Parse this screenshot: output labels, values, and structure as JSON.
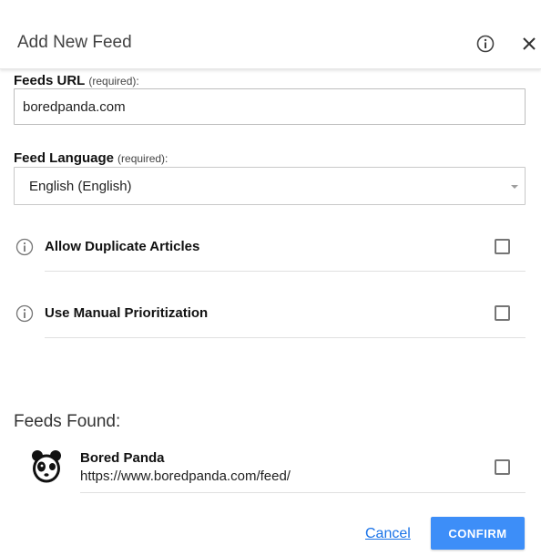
{
  "dialog": {
    "title": "Add New Feed",
    "info_icon": "info-circle-icon",
    "close_icon": "close-icon"
  },
  "feeds_url": {
    "label": "Feeds URL",
    "required_note": "(required):",
    "value": "boredpanda.com"
  },
  "feed_language": {
    "label": "Feed Language",
    "required_note": "(required):",
    "selected": "English (English)"
  },
  "options": [
    {
      "label": "Allow Duplicate Articles",
      "icon": "info-circle-icon",
      "checked": false
    },
    {
      "label": "Use Manual Prioritization",
      "icon": "info-circle-icon",
      "checked": false
    }
  ],
  "feeds_found": {
    "heading": "Feeds Found:",
    "items": [
      {
        "name": "Bored Panda",
        "url": "https://www.boredpanda.com/feed/",
        "icon": "panda-logo-icon",
        "checked": false
      }
    ]
  },
  "footer": {
    "cancel_label": "Cancel",
    "confirm_label": "CONFIRM"
  },
  "colors": {
    "accent": "#3d8ef8",
    "link": "#1a73e8"
  }
}
